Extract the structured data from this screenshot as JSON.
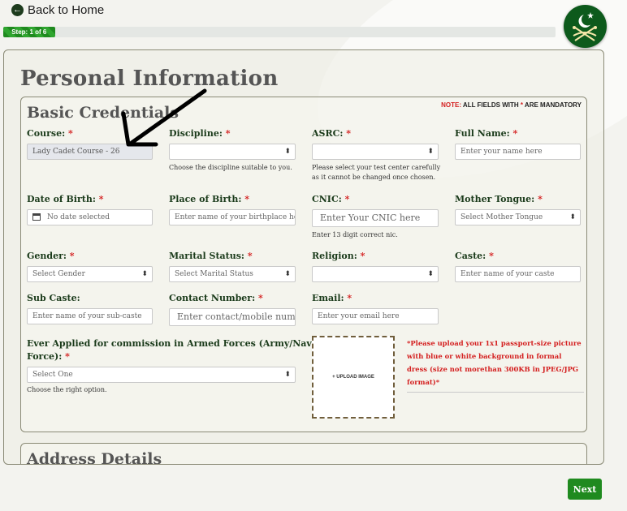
{
  "nav": {
    "back_label": "Back to Home"
  },
  "progress": {
    "label": "Step: 1 of 6",
    "fraction": 0.167
  },
  "page_title": "Personal Information",
  "section": {
    "title": "Basic Credentials",
    "note_prefix": "NOTE:",
    "note_text": " ALL FIELDS WITH ",
    "note_ast": "*",
    "note_suffix": " ARE MANDATORY"
  },
  "fields": {
    "course": {
      "label": "Course:",
      "value": "Lady Cadet Course - 26"
    },
    "discipline": {
      "label": "Discipline:",
      "value": "",
      "help": "Choose the discipline suitable to you."
    },
    "asrc": {
      "label": "ASRC:",
      "value": "",
      "help1": "Please select your test center carefully",
      "help2": "as it cannot be changed once chosen."
    },
    "full_name": {
      "label": "Full Name:",
      "placeholder": "Enter your name here"
    },
    "dob": {
      "label": "Date of Birth:",
      "value": "No date selected"
    },
    "pob": {
      "label": "Place of Birth:",
      "placeholder": "Enter name of your birthplace he"
    },
    "cnic": {
      "label": "CNIC:",
      "placeholder": "Enter Your CNIC here",
      "help": "Enter 13 digit correct nic."
    },
    "mother_tongue": {
      "label": "Mother Tongue:",
      "value": "Select Mother Tongue"
    },
    "gender": {
      "label": "Gender:",
      "value": "Select Gender"
    },
    "marital": {
      "label": "Marital Status:",
      "value": "Select Marital Status"
    },
    "religion": {
      "label": "Religion:",
      "value": ""
    },
    "caste": {
      "label": "Caste:",
      "placeholder": "Enter name of your caste"
    },
    "sub_caste": {
      "label": "Sub Caste:",
      "placeholder": "Enter name of your sub-caste"
    },
    "contact": {
      "label": "Contact Number:",
      "placeholder": "Enter contact/mobile numb"
    },
    "email": {
      "label": "Email:",
      "placeholder": "Enter your email here"
    },
    "applied": {
      "label1": "Ever Applied for commission in Armed Forces (Army/Navy/Air",
      "label2": "Force):",
      "value": "Select One",
      "help": "Choose the right option."
    }
  },
  "upload": {
    "button": "+ UPLOAD IMAGE",
    "note": "*Please upload your 1x1 passport-size picture with blue or white background in formal dress (size not morethan 300KB in JPEG/JPG format)*"
  },
  "address": {
    "title": "Address Details"
  },
  "actions": {
    "next": "Next"
  },
  "asterisk": "*",
  "colors": {
    "accent": "#1f8a1f",
    "required": "#d42020",
    "logo_bg": "#0d5a1c"
  }
}
